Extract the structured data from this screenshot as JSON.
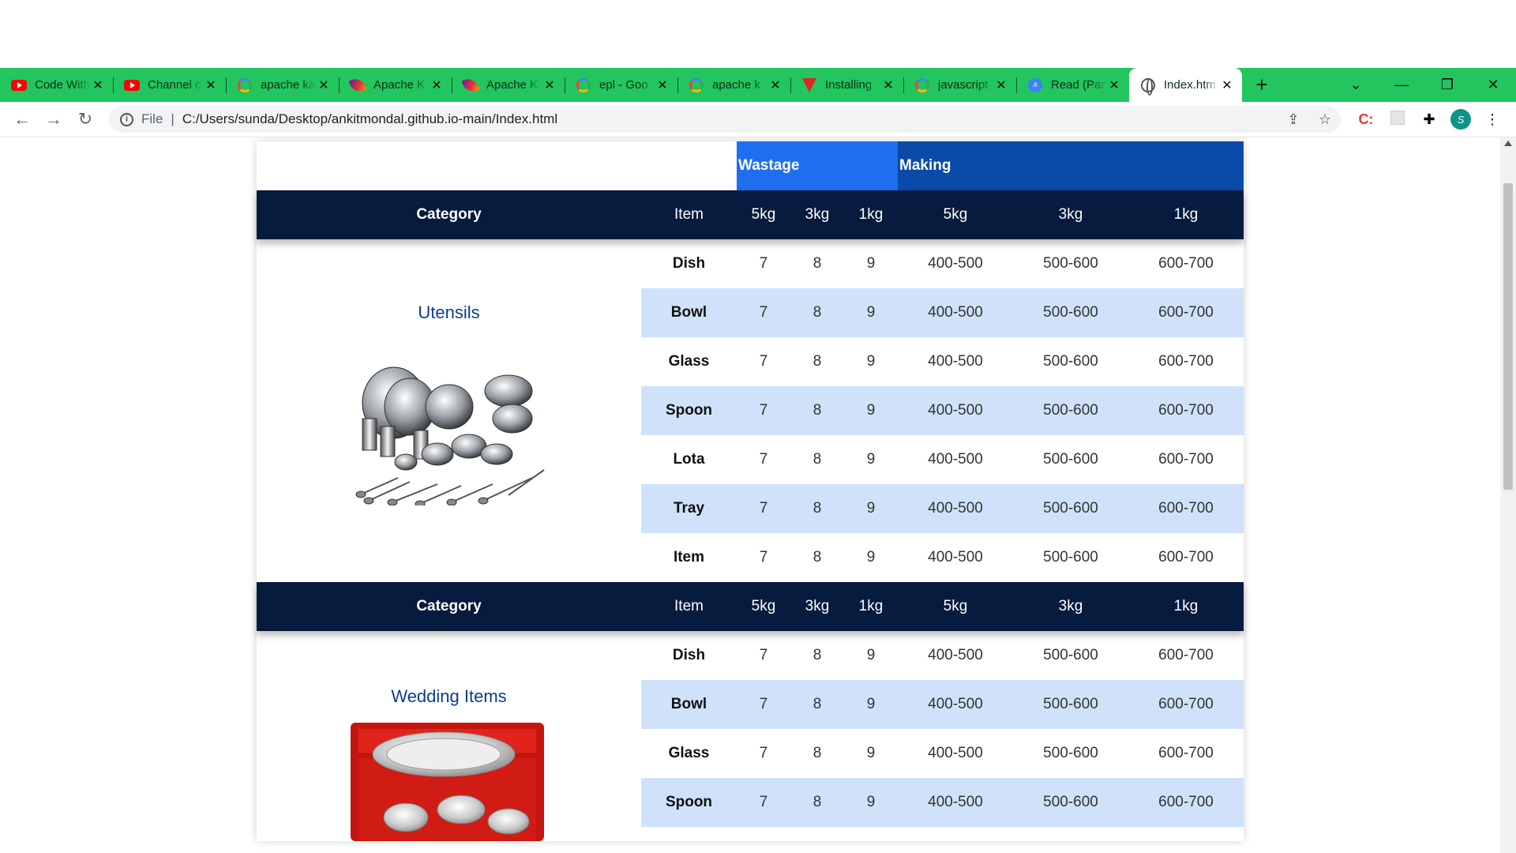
{
  "browser": {
    "tabs": [
      {
        "title": "Code With",
        "icon": "youtube-icon"
      },
      {
        "title": "Channel c",
        "icon": "youtube-icon"
      },
      {
        "title": "apache ka",
        "icon": "google-icon"
      },
      {
        "title": "Apache K",
        "icon": "feather-icon"
      },
      {
        "title": "Apache K",
        "icon": "feather-icon"
      },
      {
        "title": "epl - Goo",
        "icon": "google-icon"
      },
      {
        "title": "apache k",
        "icon": "google-icon"
      },
      {
        "title": "Installing",
        "icon": "vivaldi-icon"
      },
      {
        "title": "javascript",
        "icon": "google-icon"
      },
      {
        "title": "Read (Par",
        "icon": "read-icon"
      },
      {
        "title": "Index.htm",
        "icon": "globe-icon",
        "active": true
      }
    ],
    "close_glyph": "✕",
    "new_tab_glyph": "+",
    "address": {
      "scheme": "File",
      "separator": "|",
      "url": "C:/Users/sunda/Desktop/ankitmondal.github.io-main/Index.html"
    },
    "avatar_letter": "S"
  },
  "table": {
    "group_headers": {
      "wastage": "Wastage",
      "making": "Making"
    },
    "columns": {
      "category": "Category",
      "item": "Item",
      "w5": "5kg",
      "w3": "3kg",
      "w1": "1kg",
      "m5": "5kg",
      "m3": "3kg",
      "m1": "1kg"
    },
    "sections": [
      {
        "category": "Utensils",
        "rows": [
          {
            "item": "Dish",
            "w5": "7",
            "w3": "8",
            "w1": "9",
            "m5": "400-500",
            "m3": "500-600",
            "m1": "600-700"
          },
          {
            "item": "Bowl",
            "w5": "7",
            "w3": "8",
            "w1": "9",
            "m5": "400-500",
            "m3": "500-600",
            "m1": "600-700"
          },
          {
            "item": "Glass",
            "w5": "7",
            "w3": "8",
            "w1": "9",
            "m5": "400-500",
            "m3": "500-600",
            "m1": "600-700"
          },
          {
            "item": "Spoon",
            "w5": "7",
            "w3": "8",
            "w1": "9",
            "m5": "400-500",
            "m3": "500-600",
            "m1": "600-700"
          },
          {
            "item": "Lota",
            "w5": "7",
            "w3": "8",
            "w1": "9",
            "m5": "400-500",
            "m3": "500-600",
            "m1": "600-700"
          },
          {
            "item": "Tray",
            "w5": "7",
            "w3": "8",
            "w1": "9",
            "m5": "400-500",
            "m3": "500-600",
            "m1": "600-700"
          },
          {
            "item": "Item",
            "w5": "7",
            "w3": "8",
            "w1": "9",
            "m5": "400-500",
            "m3": "500-600",
            "m1": "600-700"
          }
        ]
      },
      {
        "category": "Wedding Items",
        "rows": [
          {
            "item": "Dish",
            "w5": "7",
            "w3": "8",
            "w1": "9",
            "m5": "400-500",
            "m3": "500-600",
            "m1": "600-700"
          },
          {
            "item": "Bowl",
            "w5": "7",
            "w3": "8",
            "w1": "9",
            "m5": "400-500",
            "m3": "500-600",
            "m1": "600-700"
          },
          {
            "item": "Glass",
            "w5": "7",
            "w3": "8",
            "w1": "9",
            "m5": "400-500",
            "m3": "500-600",
            "m1": "600-700"
          },
          {
            "item": "Spoon",
            "w5": "7",
            "w3": "8",
            "w1": "9",
            "m5": "400-500",
            "m3": "500-600",
            "m1": "600-700"
          }
        ]
      }
    ]
  },
  "colors": {
    "tabstrip": "#22c55e",
    "header_dark": "#061b3d",
    "wastage": "#1e6ff0",
    "making": "#0a4aa8",
    "row_alt": "#cfe2fa",
    "category_text": "#0d3c8c"
  }
}
